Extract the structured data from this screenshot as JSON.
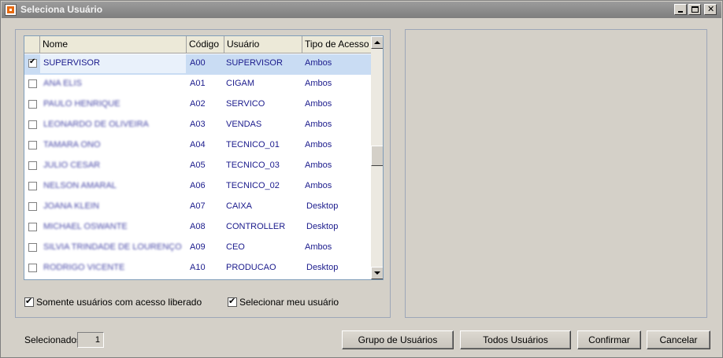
{
  "window": {
    "title": "Seleciona Usuário",
    "close_glyph": "✕"
  },
  "grid": {
    "columns": [
      "Nome",
      "Código",
      "Usuário",
      "Tipo de Acesso"
    ],
    "rows": [
      {
        "checked": true,
        "name": "SUPERVISOR",
        "code": "A00",
        "user": "SUPERVISOR",
        "access": "Ambos"
      },
      {
        "checked": false,
        "name": "ANA ELIS",
        "code": "A01",
        "user": "CIGAM",
        "access": "Ambos"
      },
      {
        "checked": false,
        "name": "PAULO HENRIQUE",
        "code": "A02",
        "user": "SERVICO",
        "access": "Ambos"
      },
      {
        "checked": false,
        "name": "LEONARDO DE OLIVEIRA",
        "code": "A03",
        "user": "VENDAS",
        "access": "Ambos"
      },
      {
        "checked": false,
        "name": "TAMARA ONO",
        "code": "A04",
        "user": "TECNICO_01",
        "access": "Ambos"
      },
      {
        "checked": false,
        "name": "JULIO CESAR",
        "code": "A05",
        "user": "TECNICO_03",
        "access": "Ambos"
      },
      {
        "checked": false,
        "name": "NELSON AMARAL",
        "code": "A06",
        "user": "TECNICO_02",
        "access": "Ambos"
      },
      {
        "checked": false,
        "name": "JOANA KLEIN",
        "code": "A07",
        "user": "CAIXA",
        "access": "Desktop"
      },
      {
        "checked": false,
        "name": "MICHAEL OSWANTE",
        "code": "A08",
        "user": "CONTROLLER",
        "access": "Desktop"
      },
      {
        "checked": false,
        "name": "SILVIA TRINDADE DE LOURENÇO",
        "code": "A09",
        "user": "CEO",
        "access": "Ambos"
      },
      {
        "checked": false,
        "name": "RODRIGO VICENTE",
        "code": "A10",
        "user": "PRODUCAO",
        "access": "Desktop"
      }
    ]
  },
  "options": {
    "only_released_label": "Somente usuários com acesso liberado",
    "select_my_user_label": "Selecionar meu usuário"
  },
  "footer": {
    "selected_label": "Selecionados",
    "selected_count": "1",
    "group_button": "Grupo de Usuários",
    "all_button": "Todos Usuários",
    "confirm_button": "Confirmar",
    "cancel_button": "Cancelar"
  },
  "colors": {
    "selection": "#c9dcf3",
    "cell_text": "#1a1a8c"
  },
  "icons": {
    "app": "app-icon",
    "minimize": "minimize-icon",
    "maximize": "maximize-icon",
    "close": "close-icon"
  }
}
